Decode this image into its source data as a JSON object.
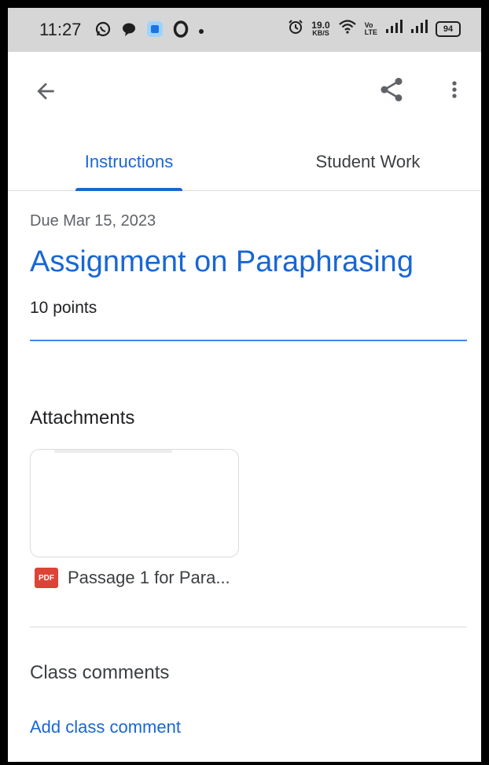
{
  "status_bar": {
    "time": "11:27",
    "speed_value": "19.0",
    "speed_unit": "KB/S",
    "volte_top": "Vo",
    "volte_bottom": "LTE",
    "battery": "94",
    "left_icons": [
      "whatsapp-icon",
      "chat-bubble-icon",
      "app-icon",
      "opera-icon",
      "dot-icon"
    ],
    "right_icons": [
      "alarm-icon",
      "wifi-icon",
      "signal-icon",
      "signal-icon"
    ]
  },
  "appbar": {
    "icons": [
      "back-arrow-icon",
      "share-icon",
      "more-vert-icon"
    ]
  },
  "tabs": [
    {
      "label": "Instructions",
      "active": true
    },
    {
      "label": "Student Work",
      "active": false
    }
  ],
  "assignment": {
    "due": "Due Mar 15, 2023",
    "title": "Assignment on Paraphrasing",
    "points": "10 points"
  },
  "attachments": {
    "heading": "Attachments",
    "files": [
      {
        "type_label": "PDF",
        "name": "Passage 1 for Para..."
      }
    ]
  },
  "comments": {
    "heading": "Class comments",
    "add_label": "Add class comment"
  },
  "colors": {
    "accent": "#1967d2",
    "status_bar_bg": "#d6d6d6",
    "pdf_red": "#db4437",
    "divider": "#dadce0"
  }
}
